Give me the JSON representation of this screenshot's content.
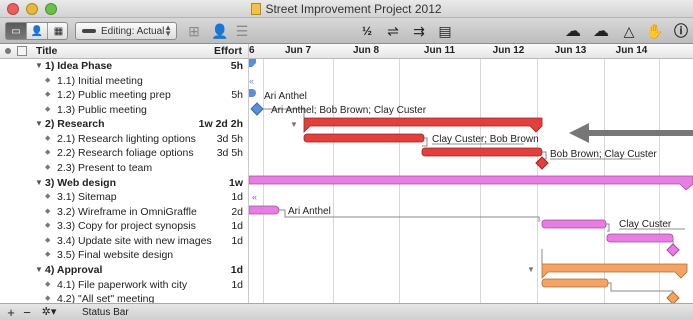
{
  "window": {
    "title": "Street Improvement Project 2012"
  },
  "toolbar": {
    "baseline_label": "Editing: Actual",
    "icons": [
      "outline-view-icon",
      "resources-view-icon",
      "calendar-view-icon",
      "connect-icon",
      "assign-resource-icon",
      "level-icon",
      "fraction-icon",
      "split-icon",
      "join-icon",
      "inspector-icon",
      "catch-up-icon",
      "violation-icon",
      "milestone-icon",
      "stop-icon",
      "info-icon"
    ]
  },
  "outline": {
    "header": {
      "title": "Title",
      "effort": "Effort"
    },
    "rows": [
      {
        "num": "1)",
        "title": "Idea Phase",
        "effort": "5h",
        "group": true
      },
      {
        "num": "1.1)",
        "title": "Initial meeting",
        "effort": "",
        "group": false
      },
      {
        "num": "1.2)",
        "title": "Public meeting prep",
        "effort": "5h",
        "group": false
      },
      {
        "num": "1.3)",
        "title": "Public meeting",
        "effort": "",
        "group": false
      },
      {
        "num": "2)",
        "title": "Research",
        "effort": "1w 2d 2h",
        "group": true
      },
      {
        "num": "2.1)",
        "title": "Research lighting options",
        "effort": "3d 5h",
        "group": false
      },
      {
        "num": "2.2)",
        "title": "Research foliage options",
        "effort": "3d 5h",
        "group": false
      },
      {
        "num": "2.3)",
        "title": "Present to team",
        "effort": "",
        "group": false
      },
      {
        "num": "3)",
        "title": "Web design",
        "effort": "1w",
        "group": true
      },
      {
        "num": "3.1)",
        "title": "Sitemap",
        "effort": "1d",
        "group": false
      },
      {
        "num": "3.2)",
        "title": "Wireframe in OmniGraffle",
        "effort": "2d",
        "group": false
      },
      {
        "num": "3.3)",
        "title": "Copy for project synopsis",
        "effort": "1d",
        "group": false
      },
      {
        "num": "3.4)",
        "title": "Update site with new images",
        "effort": "1d",
        "group": false
      },
      {
        "num": "3.5)",
        "title": "Final website design",
        "effort": "",
        "group": false
      },
      {
        "num": "4)",
        "title": "Approval",
        "effort": "1d",
        "group": true
      },
      {
        "num": "4.1)",
        "title": "File paperwork with city",
        "effort": "1d",
        "group": false
      },
      {
        "num": "4.2)",
        "title": "\"All set\" meeting",
        "effort": "",
        "group": false
      }
    ]
  },
  "gantt": {
    "dates": [
      "6",
      "Jun 7",
      "Jun 8",
      "Jun 11",
      "Jun 12",
      "Jun 13",
      "Jun 14"
    ],
    "labels": [
      {
        "text": "Ari Anthel",
        "row": 2
      },
      {
        "text": "Ari Anthel; Bob Brown; Clay Custer",
        "row": 3
      },
      {
        "text": "Clay Custer; Bob Brown",
        "row": 6
      },
      {
        "text": "Bob Brown; Clay Custer",
        "row": 7
      },
      {
        "text": "Ari Anthel",
        "row": 10
      },
      {
        "text": "Clay Custer",
        "row": 11
      }
    ],
    "colors": {
      "research": "#e2403c",
      "web": "#e77fe2",
      "approval": "#f3a465",
      "idea": "#5a8fd6"
    }
  },
  "statusbar": {
    "plus": "+",
    "minus": "−",
    "gear": "✲▾",
    "text": "Status Bar"
  }
}
